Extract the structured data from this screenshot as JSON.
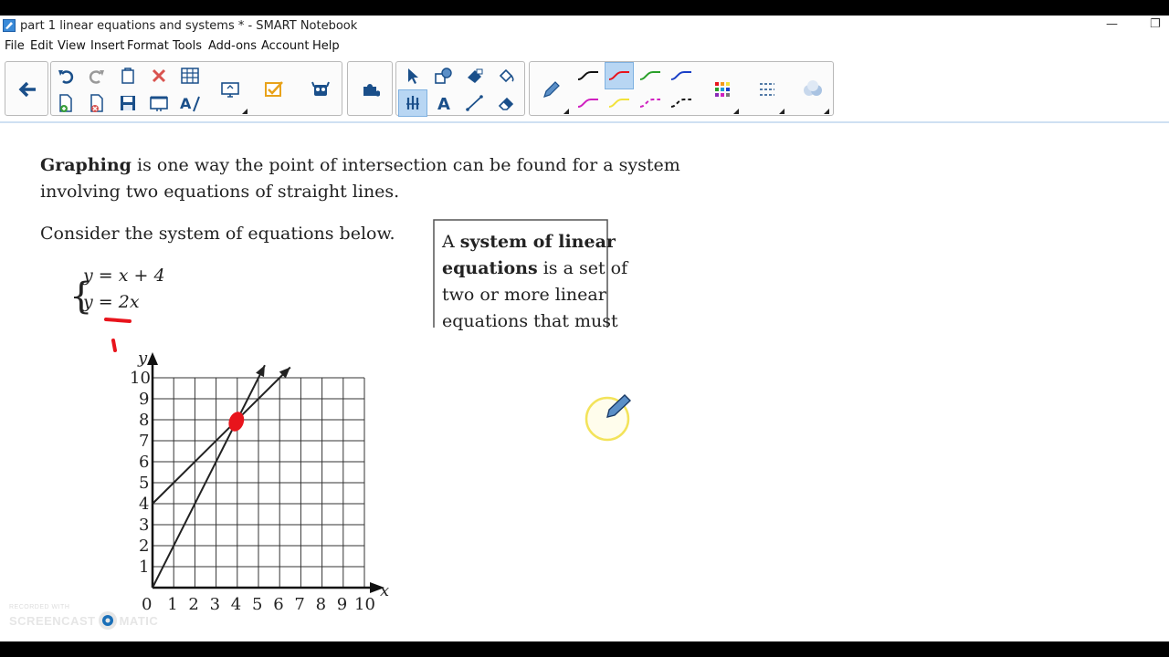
{
  "window": {
    "title": "part 1  linear equations and systems * - SMART Notebook",
    "minimize": "—",
    "restore": "❐"
  },
  "menu": [
    "File",
    "Edit",
    "View",
    "Insert",
    "Format",
    "Tools",
    "Add-ons",
    "Account",
    "Help"
  ],
  "colors": {
    "ink_red": "#e8141c",
    "pen_blue": "#5b8fc7",
    "cursor_ring": "#f3e35a",
    "toolbar_selected": "#b8d6f3"
  },
  "toolbar": {
    "icons": [
      "back-arrow-icon",
      "undo-icon",
      "redo-icon",
      "paste-icon",
      "delete-icon",
      "table-icon",
      "new-page-icon",
      "delete-page-icon",
      "save-icon",
      "full-screen-icon",
      "handwriting-recognition-icon",
      "screen-share-icon",
      "response-icon",
      "lab-activities-icon",
      "add-ons-icon",
      "select-icon",
      "shapes-icon",
      "fill-icon",
      "paint-bucket-icon",
      "magic-pen-icon",
      "text-icon",
      "line-icon",
      "eraser-icon",
      "pen-icon",
      "pen-style-icon",
      "color-palette-icon",
      "properties-icon",
      "fill-effects-icon"
    ]
  },
  "slide": {
    "intro_bold": "Graphing",
    "intro_rest_line1": " is one way the point of intersection can be found for a system",
    "intro_line2": "involving two equations of straight lines.",
    "consider": "Consider the system of equations below.",
    "eq1": "y = x + 4",
    "eq2": "y = 2x",
    "callout": {
      "prefix": "A ",
      "bold1": "system of linear",
      "bold2": "equations",
      "rest2": " is a set of",
      "line3": "two or more linear",
      "line4": "equations that must"
    }
  },
  "chart_data": {
    "type": "line",
    "xlabel": "x",
    "ylabel": "y",
    "xlim": [
      0,
      10
    ],
    "ylim": [
      0,
      10
    ],
    "grid": true,
    "x_ticks": [
      "0",
      "1",
      "2",
      "3",
      "4",
      "5",
      "6",
      "7",
      "8",
      "9",
      "10"
    ],
    "y_ticks": [
      "1",
      "2",
      "3",
      "4",
      "5",
      "6",
      "7",
      "8",
      "9",
      "10"
    ],
    "series": [
      {
        "name": "",
        "x": [
          0,
          6.5
        ],
        "y": [
          4,
          10.5
        ]
      },
      {
        "name": "",
        "x": [
          0,
          5.3
        ],
        "y": [
          0,
          10.6
        ]
      }
    ],
    "annotations": [
      {
        "x": 4,
        "y": 8,
        "marker": "red dot"
      }
    ]
  },
  "watermark": {
    "recorded": "RECORDED WITH",
    "brand_left": "SCREENCAST",
    "brand_right": "MATIC"
  }
}
